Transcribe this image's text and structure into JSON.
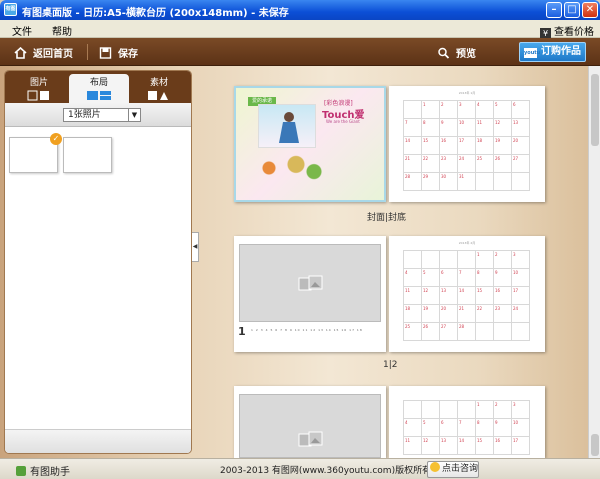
{
  "window": {
    "title": "有图桌面版 - 日历:A5-横款台历 (200x148mm) - 未保存",
    "app_icon": "youtu-logo-icon"
  },
  "menu": {
    "items": [
      "文件",
      "帮助"
    ],
    "price_label": "查看价格"
  },
  "toolbar": {
    "home_label": "返回首页",
    "save_label": "保存",
    "preview_label": "预览",
    "order_label": "订购作品",
    "order_logo": "youtu"
  },
  "panel": {
    "tabs": [
      {
        "label": "图片"
      },
      {
        "label": "布局"
      },
      {
        "label": "素材"
      }
    ],
    "active_tab": "布局",
    "photo_select": "1张照片"
  },
  "pages": {
    "captions": [
      "封面|封底",
      "1|2"
    ],
    "cover": {
      "tag": "爱的承诺",
      "title_cn": "[彩色浪漫]",
      "title_en": "Touch",
      "title_love": "爱",
      "sub": "We are the Giant"
    },
    "calendar_label": "2013年 1月",
    "calendar2_label": "2013年 2月",
    "page1_number": "1"
  },
  "status": {
    "assistant_label": "有图助手",
    "copyright": "2003-2013 有图网(www.360youtu.com)版权所有",
    "consult_label": "点击咨询"
  },
  "colors": {
    "titlebar": "#0b4fd6",
    "toolbar": "#6a3c1a",
    "accent": "#2a88dc",
    "calendar_mark": "#d04050"
  }
}
